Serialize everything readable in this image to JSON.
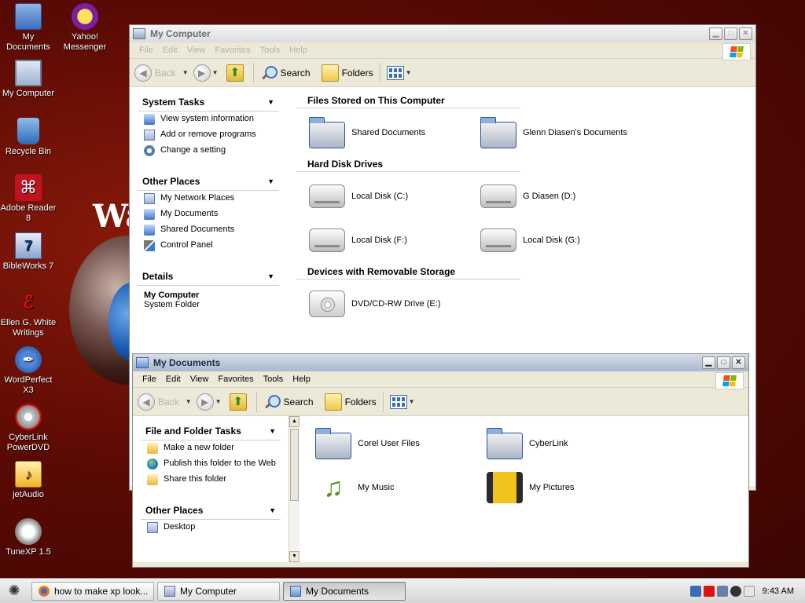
{
  "desktop": {
    "icons": [
      {
        "label": "My Documents",
        "icon": "my-documents-icon"
      },
      {
        "label": "Yahoo! Messenger",
        "icon": "yahoo-messenger-icon"
      },
      {
        "label": "My Computer",
        "icon": "my-computer-icon"
      },
      {
        "label": "Recycle Bin",
        "icon": "recycle-bin-icon"
      },
      {
        "label": "Adobe Reader 8",
        "icon": "adobe-reader-icon"
      },
      {
        "label": "BibleWorks 7",
        "icon": "bibleworks-icon"
      },
      {
        "label": "Ellen G. White Writings",
        "icon": "egw-icon"
      },
      {
        "label": "WordPerfect X3",
        "icon": "wordperfect-icon"
      },
      {
        "label": "CyberLink PowerDVD",
        "icon": "powerdvd-icon"
      },
      {
        "label": "jetAudio",
        "icon": "jetaudio-icon"
      },
      {
        "label": "TuneXP 1.5",
        "icon": "tunexp-icon"
      }
    ],
    "wallpaper_text": "Wa"
  },
  "my_computer": {
    "title": "My Computer",
    "menu": [
      "File",
      "Edit",
      "View",
      "Favorites",
      "Tools",
      "Help"
    ],
    "toolbar": {
      "back": "Back",
      "search": "Search",
      "folders": "Folders"
    },
    "system_tasks": {
      "title": "System Tasks",
      "items": [
        "View system information",
        "Add or remove programs",
        "Change a setting"
      ]
    },
    "other_places": {
      "title": "Other Places",
      "items": [
        "My Network Places",
        "My Documents",
        "Shared Documents",
        "Control Panel"
      ]
    },
    "details": {
      "title": "Details",
      "name": "My Computer",
      "type": "System Folder"
    },
    "sections": {
      "files": {
        "title": "Files Stored on This Computer",
        "items": [
          "Shared Documents",
          "Glenn Diasen's Documents"
        ]
      },
      "drives": {
        "title": "Hard Disk Drives",
        "items": [
          "Local Disk (C:)",
          "G Diasen (D:)",
          "Local Disk (F:)",
          "Local Disk (G:)"
        ]
      },
      "removable": {
        "title": "Devices with Removable Storage",
        "items": [
          "DVD/CD-RW Drive (E:)"
        ]
      }
    }
  },
  "my_documents": {
    "title": "My Documents",
    "menu": [
      "File",
      "Edit",
      "View",
      "Favorites",
      "Tools",
      "Help"
    ],
    "toolbar": {
      "back": "Back",
      "search": "Search",
      "folders": "Folders"
    },
    "file_tasks": {
      "title": "File and Folder Tasks",
      "items": [
        "Make a new folder",
        "Publish this folder to the Web",
        "Share this folder"
      ]
    },
    "other_places": {
      "title": "Other Places",
      "items": [
        "Desktop"
      ]
    },
    "items": [
      "Corel User Files",
      "CyberLink",
      "My Music",
      "My Pictures"
    ]
  },
  "taskbar": {
    "buttons": [
      "how to make xp look...",
      "My Computer",
      "My Documents"
    ],
    "clock": "9:43 AM"
  }
}
